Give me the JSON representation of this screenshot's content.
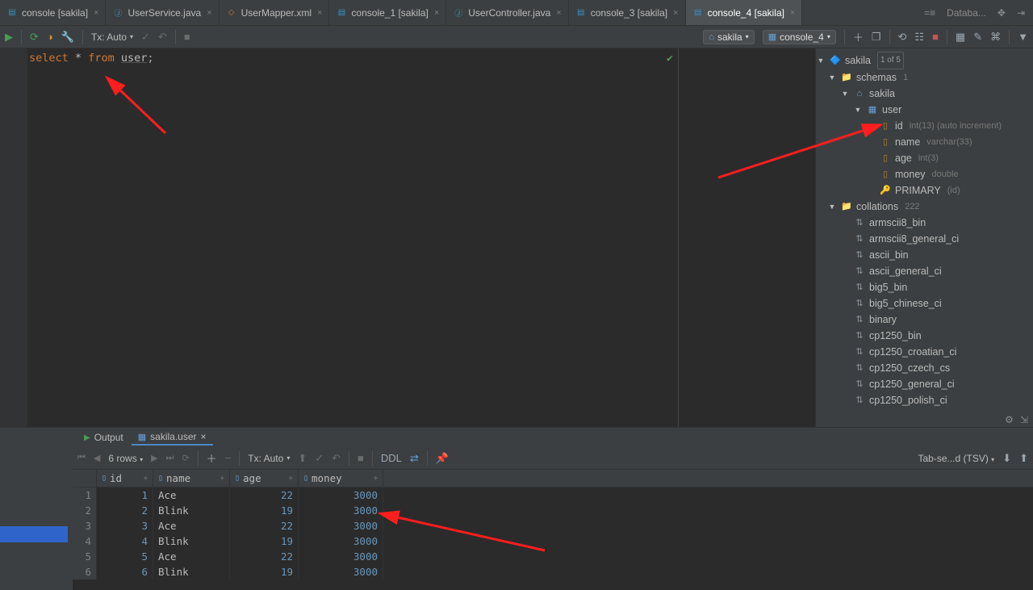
{
  "tabs": [
    {
      "label": "console [sakila]",
      "type": "db"
    },
    {
      "label": "UserService.java",
      "type": "java"
    },
    {
      "label": "UserMapper.xml",
      "type": "xml"
    },
    {
      "label": "console_1 [sakila]",
      "type": "db"
    },
    {
      "label": "UserController.java",
      "type": "java"
    },
    {
      "label": "console_3 [sakila]",
      "type": "db"
    },
    {
      "label": "console_4 [sakila]",
      "type": "db",
      "active": true
    }
  ],
  "tabbar_right": {
    "eq": "=≡",
    "db_label": "Databa..."
  },
  "toolbar1": {
    "tx": "Tx: Auto",
    "schema": "sakila",
    "console": "console_4"
  },
  "editor": {
    "sql_select": "select",
    "sql_star": "*",
    "sql_from": "from",
    "sql_table": "user",
    "sql_end": ";"
  },
  "tree": {
    "root": "sakila",
    "root_meta": "1 of 5",
    "schemas": "schemas",
    "schemas_count": "1",
    "schema_name": "sakila",
    "table": "user",
    "columns": [
      {
        "name": "id",
        "meta": "int(13) (auto increment)"
      },
      {
        "name": "name",
        "meta": "varchar(33)"
      },
      {
        "name": "age",
        "meta": "int(3)"
      },
      {
        "name": "money",
        "meta": "double"
      }
    ],
    "primary": "PRIMARY",
    "primary_meta": "(id)",
    "collations": "collations",
    "collations_count": "222",
    "collation_list": [
      "armscii8_bin",
      "armscii8_general_ci",
      "ascii_bin",
      "ascii_general_ci",
      "big5_bin",
      "big5_chinese_ci",
      "binary",
      "cp1250_bin",
      "cp1250_croatian_ci",
      "cp1250_czech_cs",
      "cp1250_general_ci",
      "cp1250_polish_ci"
    ]
  },
  "results": {
    "tab_output": "Output",
    "tab_table": "sakila.user",
    "rows_label": "6 rows",
    "tx": "Tx: Auto",
    "ddl": "DDL",
    "tabsep": "Tab-se...d (TSV)",
    "headers": [
      "id",
      "name",
      "age",
      "money"
    ],
    "rows": [
      {
        "idx": "1",
        "id": "1",
        "name": "Ace",
        "age": "22",
        "money": "3000"
      },
      {
        "idx": "2",
        "id": "2",
        "name": "Blink",
        "age": "19",
        "money": "3000"
      },
      {
        "idx": "3",
        "id": "3",
        "name": "Ace",
        "age": "22",
        "money": "3000"
      },
      {
        "idx": "4",
        "id": "4",
        "name": "Blink",
        "age": "19",
        "money": "3000"
      },
      {
        "idx": "5",
        "id": "5",
        "name": "Ace",
        "age": "22",
        "money": "3000"
      },
      {
        "idx": "6",
        "id": "6",
        "name": "Blink",
        "age": "19",
        "money": "3000"
      }
    ]
  }
}
